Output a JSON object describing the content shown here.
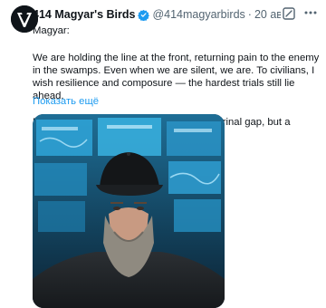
{
  "tweet": {
    "author_name": "414 Magyar's Birds",
    "handle": "@414magyarbirds",
    "separator": "·",
    "date": "20 авг.",
    "paragraphs": [
      "Magyar:",
      "We are holding the line at the front, returning pain to the enemy in the swamps. Even when we are silent, we are. To civilians, I wish resilience and composure — the hardest trials still lie ahead.",
      "Between the enemy and us lies not a doctrinal gap, but a civilizational"
    ],
    "show_more": "Показать ещё"
  },
  "icons": {
    "verified": "verified-badge-icon",
    "grok": "grok-icon",
    "more": "more-options-icon"
  },
  "colors": {
    "link": "#1d9bf0",
    "secondary_text": "#536471",
    "primary_text": "#0f1419"
  }
}
